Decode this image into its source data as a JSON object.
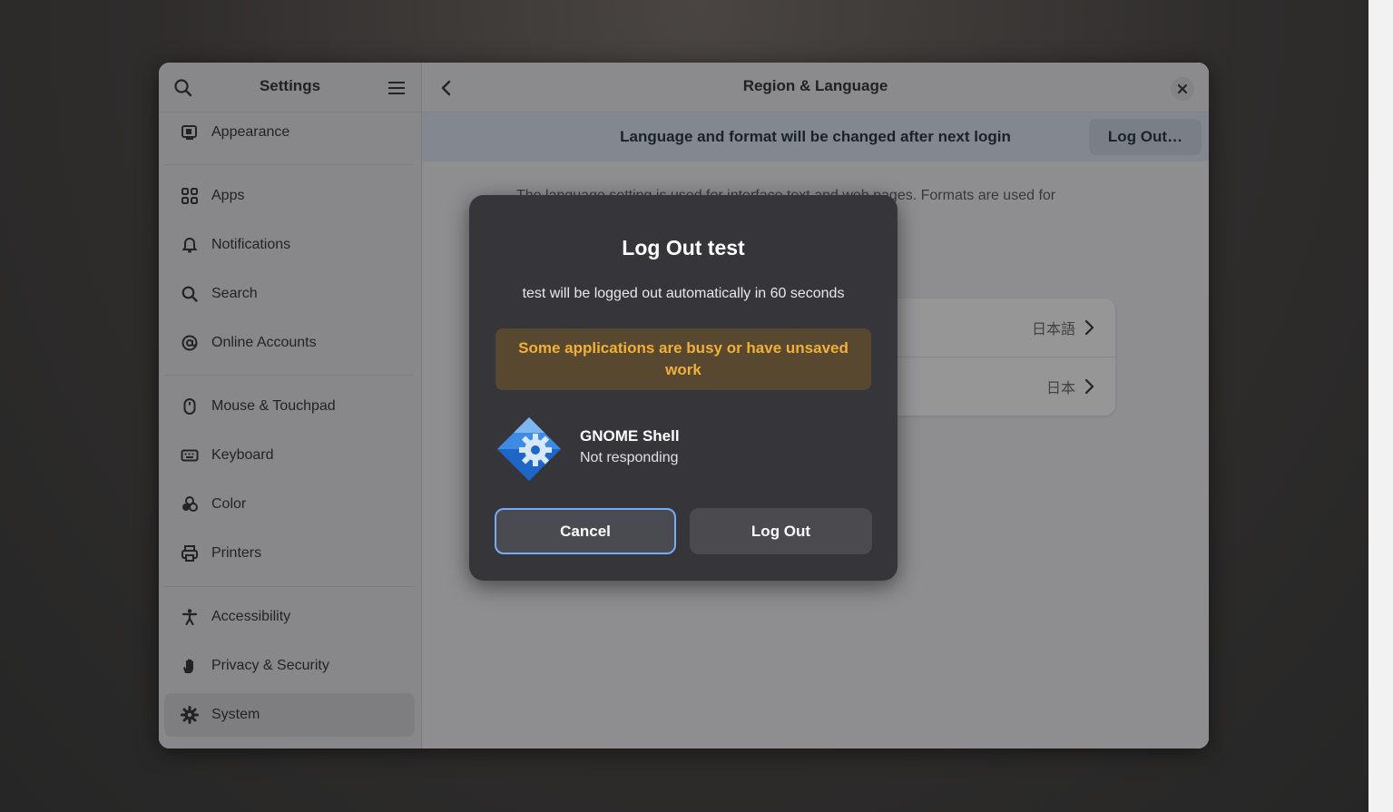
{
  "sidebar": {
    "title": "Settings",
    "items": [
      {
        "label": "Appearance",
        "icon": "appearance-icon"
      },
      {
        "label": "Apps",
        "icon": "apps-icon"
      },
      {
        "label": "Notifications",
        "icon": "bell-icon"
      },
      {
        "label": "Search",
        "icon": "search-icon"
      },
      {
        "label": "Online Accounts",
        "icon": "at-icon"
      },
      {
        "label": "Mouse & Touchpad",
        "icon": "mouse-icon"
      },
      {
        "label": "Keyboard",
        "icon": "keyboard-icon"
      },
      {
        "label": "Color",
        "icon": "color-icon"
      },
      {
        "label": "Printers",
        "icon": "printer-icon"
      },
      {
        "label": "Accessibility",
        "icon": "accessibility-icon"
      },
      {
        "label": "Privacy & Security",
        "icon": "hand-icon"
      },
      {
        "label": "System",
        "icon": "gear-icon"
      }
    ],
    "active": "System"
  },
  "main": {
    "title": "Region & Language",
    "banner": {
      "text": "Language and format will be changed after next login",
      "button": "Log Out…"
    },
    "description": "The language setting is used for interface text and web pages. Formats are used for",
    "rows": [
      {
        "value": "日本語"
      },
      {
        "value": "日本"
      }
    ]
  },
  "dialog": {
    "title": "Log Out test",
    "subtitle": "test will be logged out automatically in 60 seconds",
    "warning": "Some applications are busy or have unsaved work",
    "app": {
      "name": "GNOME Shell",
      "status": "Not responding"
    },
    "cancel_label": "Cancel",
    "logout_label": "Log Out"
  },
  "colors": {
    "accent": "#7aaaf0",
    "warning_text": "#f0b03a",
    "warning_bg": "#58482f",
    "dialog_bg": "#36363a",
    "banner_bg": "#dde6f3"
  }
}
